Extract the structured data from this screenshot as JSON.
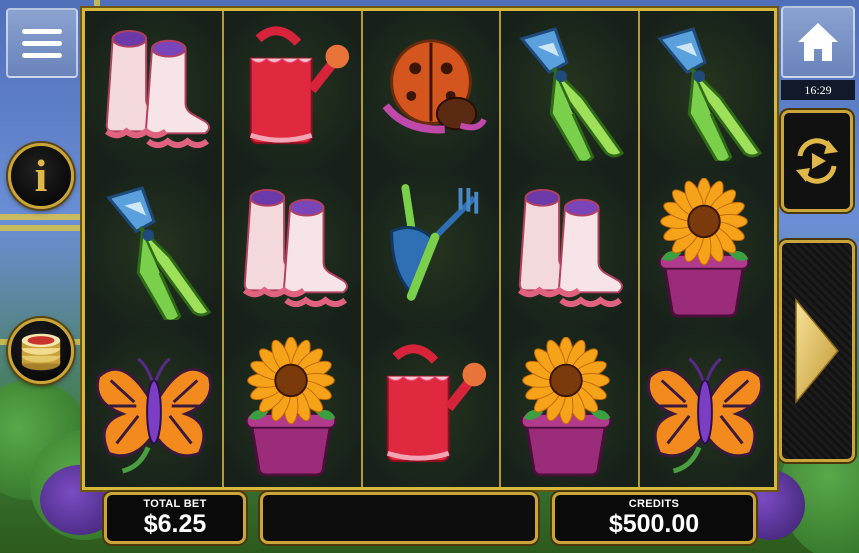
{
  "header": {
    "clock": "16:29"
  },
  "buttons": {
    "menu_icon": "hamburger-menu-icon",
    "home_icon": "home-icon",
    "info_label": "i",
    "coins_icon": "coin-stack-icon",
    "autoplay_icon": "autoplay-icon",
    "spin_icon": "play-arrow-icon"
  },
  "reels": {
    "rows": [
      [
        "boots",
        "watering-can",
        "ladybug",
        "pruning-shears",
        "pruning-shears"
      ],
      [
        "pruning-shears",
        "boots",
        "trowel-and-fork",
        "boots",
        "sunflower-pot"
      ],
      [
        "butterfly",
        "sunflower-pot",
        "watering-can",
        "sunflower-pot",
        "butterfly"
      ]
    ]
  },
  "footer": {
    "total_bet_label": "TOTAL BET",
    "total_bet_value": "$6.25",
    "message": "",
    "credits_label": "CREDITS",
    "credits_value": "$500.00"
  },
  "colors": {
    "gold": "#c9a53a",
    "panel": "#0a0a0a",
    "reel_bg": "#1e2b1e"
  }
}
